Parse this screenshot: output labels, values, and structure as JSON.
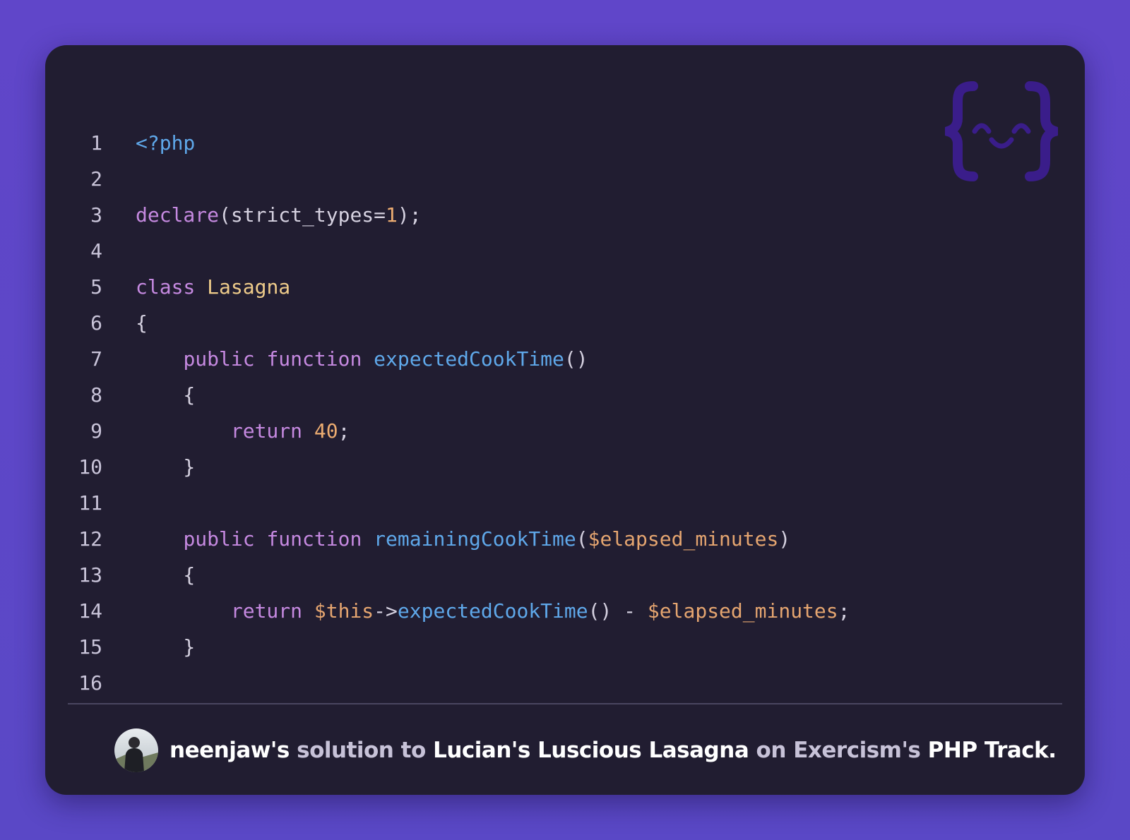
{
  "code": {
    "lines": [
      {
        "number": "1",
        "tokens": [
          {
            "text": "<?php",
            "type": "tag"
          }
        ]
      },
      {
        "number": "2",
        "tokens": []
      },
      {
        "number": "3",
        "tokens": [
          {
            "text": "declare",
            "type": "kw"
          },
          {
            "text": "(strict_types=",
            "type": "plain"
          },
          {
            "text": "1",
            "type": "num"
          },
          {
            "text": ");",
            "type": "plain"
          }
        ]
      },
      {
        "number": "4",
        "tokens": []
      },
      {
        "number": "5",
        "tokens": [
          {
            "text": "class",
            "type": "kw"
          },
          {
            "text": " ",
            "type": "plain"
          },
          {
            "text": "Lasagna",
            "type": "cls"
          }
        ]
      },
      {
        "number": "6",
        "tokens": [
          {
            "text": "{",
            "type": "plain"
          }
        ]
      },
      {
        "number": "7",
        "tokens": [
          {
            "text": "    ",
            "type": "plain"
          },
          {
            "text": "public",
            "type": "kw"
          },
          {
            "text": " ",
            "type": "plain"
          },
          {
            "text": "function",
            "type": "kw"
          },
          {
            "text": " ",
            "type": "plain"
          },
          {
            "text": "expectedCookTime",
            "type": "fn"
          },
          {
            "text": "()",
            "type": "plain"
          }
        ]
      },
      {
        "number": "8",
        "tokens": [
          {
            "text": "    {",
            "type": "plain"
          }
        ]
      },
      {
        "number": "9",
        "tokens": [
          {
            "text": "        ",
            "type": "plain"
          },
          {
            "text": "return",
            "type": "kw"
          },
          {
            "text": " ",
            "type": "plain"
          },
          {
            "text": "40",
            "type": "num"
          },
          {
            "text": ";",
            "type": "plain"
          }
        ]
      },
      {
        "number": "10",
        "tokens": [
          {
            "text": "    }",
            "type": "plain"
          }
        ]
      },
      {
        "number": "11",
        "tokens": []
      },
      {
        "number": "12",
        "tokens": [
          {
            "text": "    ",
            "type": "plain"
          },
          {
            "text": "public",
            "type": "kw"
          },
          {
            "text": " ",
            "type": "plain"
          },
          {
            "text": "function",
            "type": "kw"
          },
          {
            "text": " ",
            "type": "plain"
          },
          {
            "text": "remainingCookTime",
            "type": "fn"
          },
          {
            "text": "(",
            "type": "plain"
          },
          {
            "text": "$elapsed_minutes",
            "type": "var"
          },
          {
            "text": ")",
            "type": "plain"
          }
        ]
      },
      {
        "number": "13",
        "tokens": [
          {
            "text": "    {",
            "type": "plain"
          }
        ]
      },
      {
        "number": "14",
        "tokens": [
          {
            "text": "        ",
            "type": "plain"
          },
          {
            "text": "return",
            "type": "kw"
          },
          {
            "text": " ",
            "type": "plain"
          },
          {
            "text": "$this",
            "type": "var"
          },
          {
            "text": "->",
            "type": "plain"
          },
          {
            "text": "expectedCookTime",
            "type": "fn"
          },
          {
            "text": "() - ",
            "type": "plain"
          },
          {
            "text": "$elapsed_minutes",
            "type": "var"
          },
          {
            "text": ";",
            "type": "plain"
          }
        ]
      },
      {
        "number": "15",
        "tokens": [
          {
            "text": "    }",
            "type": "plain"
          }
        ]
      },
      {
        "number": "16",
        "tokens": []
      }
    ]
  },
  "footer": {
    "user": "neenjaw's",
    "solution_to": " solution to ",
    "exercise": "Lucian's Luscious Lasagna",
    "on": " on ",
    "site": "Exercism's",
    "track": " PHP Track."
  },
  "icons": {
    "logo": "exercism-curly-brace-logo",
    "avatar": "user-avatar"
  },
  "colors": {
    "background": "#5b48c8",
    "card": "#211d31",
    "keyword": "#c589e0",
    "function": "#5fa8ea",
    "class": "#eecb8a",
    "number": "#ecac71",
    "variable": "#e5a570",
    "logo": "#3d1f8e"
  }
}
